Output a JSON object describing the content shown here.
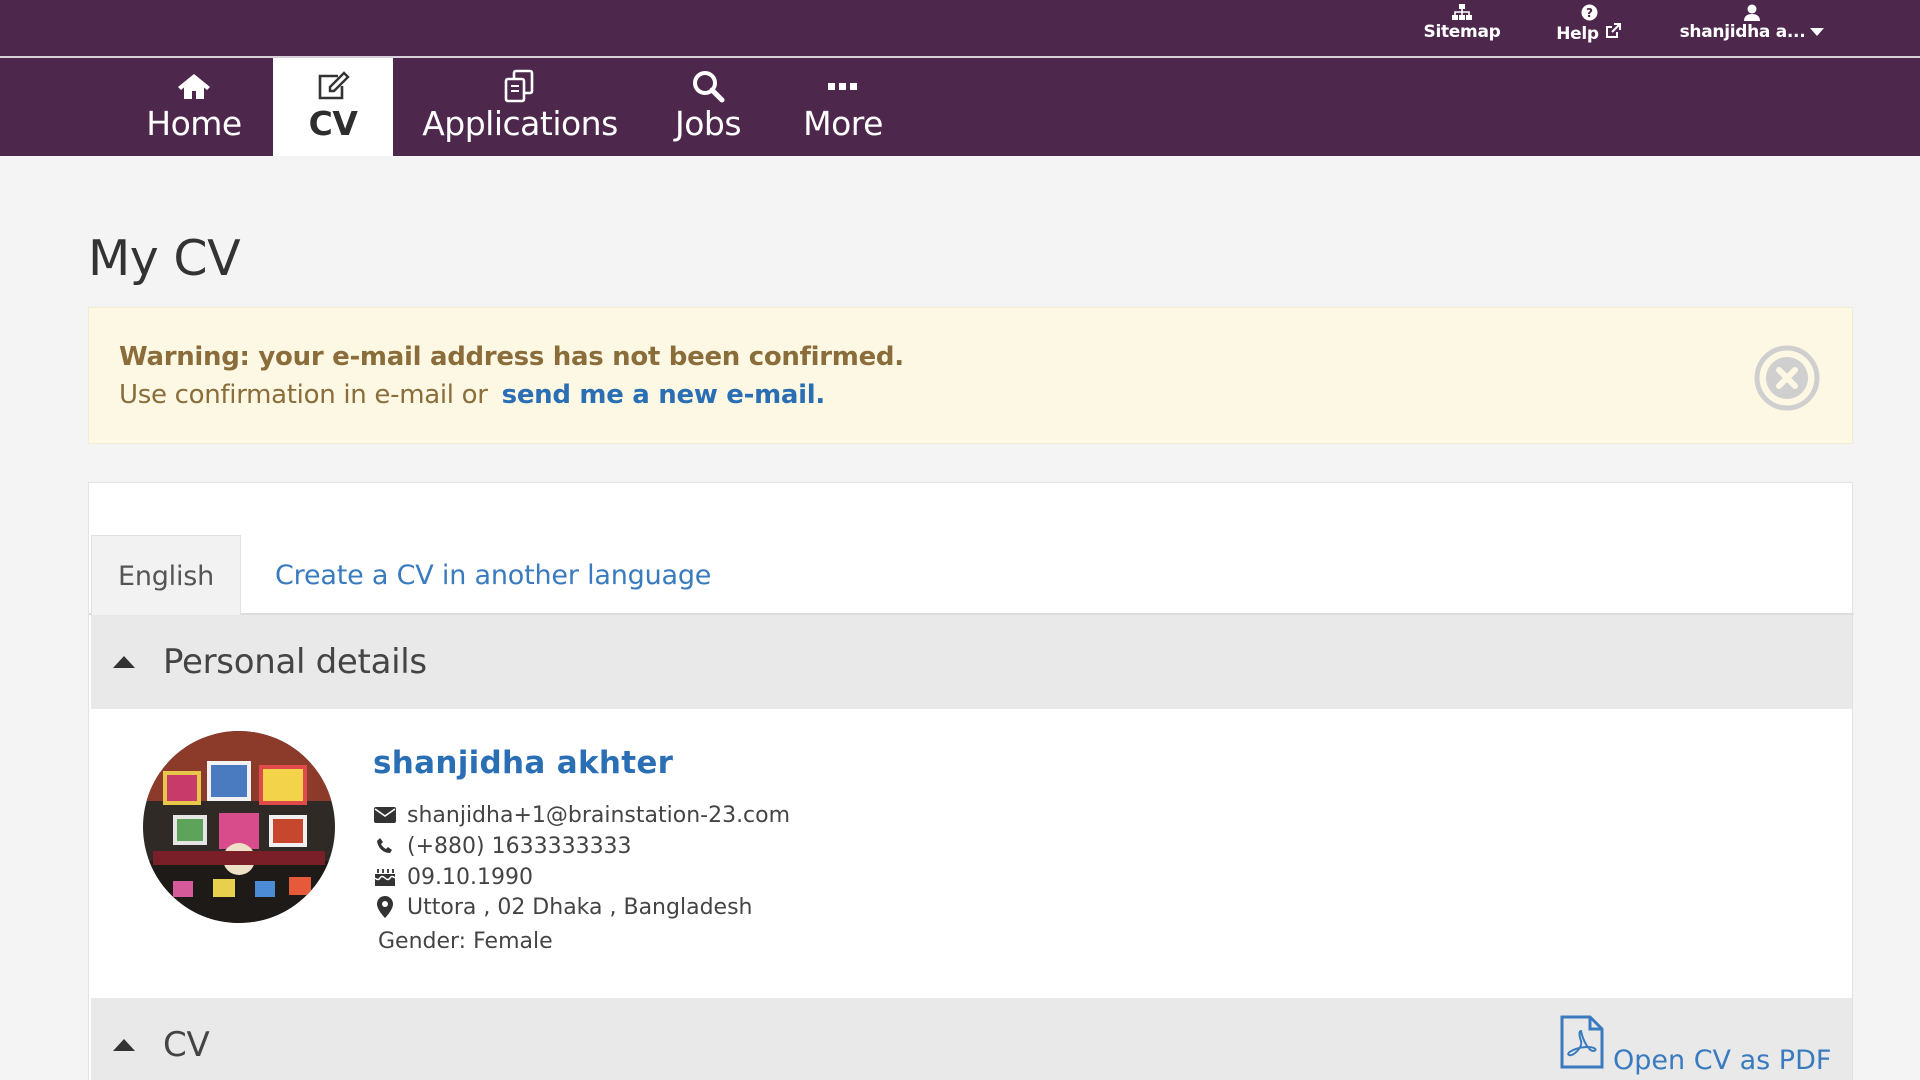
{
  "utility": {
    "sitemap_label": "Sitemap",
    "help_label": "Help",
    "user_label": "shanjidha a..."
  },
  "nav": {
    "home": "Home",
    "cv": "CV",
    "applications": "Applications",
    "jobs": "Jobs",
    "more": "More",
    "active": "CV"
  },
  "page": {
    "title": "My CV"
  },
  "warning": {
    "title": "Warning: your e-mail address has not been confirmed.",
    "text": "Use confirmation in e-mail or",
    "link": "send me a new e-mail."
  },
  "tabs": {
    "english": "English",
    "create_other": "Create a CV in another language"
  },
  "personal": {
    "section_title": "Personal details",
    "name": "shanjidha akhter",
    "email": "shanjidha+1@brainstation-23.com",
    "phone": "(+880) 1633333333",
    "birthdate": "09.10.1990",
    "address": "Uttora , 02 Dhaka , Bangladesh",
    "gender": "Gender: Female"
  },
  "cv_section": {
    "title": "CV",
    "pdf_link": "Open CV as PDF"
  },
  "colors": {
    "brand": "#4d284c",
    "link": "#2a6eb4",
    "warning_bg": "#fcf8e3",
    "warning_text": "#8a6d3b"
  },
  "icons": [
    "sitemap-icon",
    "help-icon",
    "external-link-icon",
    "user-icon",
    "caret-down-icon",
    "home-icon",
    "edit-icon",
    "applications-icon",
    "search-icon",
    "more-icon",
    "close-circle-icon",
    "caret-up-icon",
    "envelope-icon",
    "phone-icon",
    "birthday-cake-icon",
    "map-marker-icon",
    "pdf-file-icon"
  ]
}
